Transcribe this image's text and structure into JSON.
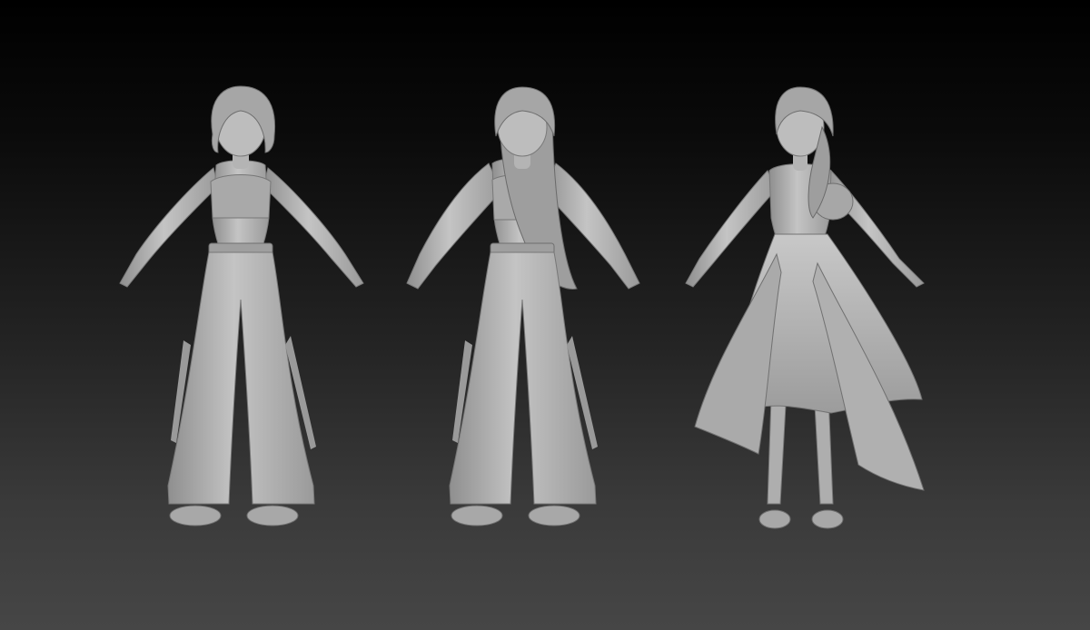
{
  "scene": {
    "background": {
      "top": "#000000",
      "bottom": "#464646"
    },
    "clay_color": "#b9b9b9",
    "clay_shadow": "#8a8a8a",
    "clay_highlight": "#d2d2d2"
  },
  "figures": [
    {
      "id": "fig-1",
      "outfit": "crop-top-cargo-pants",
      "hair": "short-bob"
    },
    {
      "id": "fig-2",
      "outfit": "jacket-cargo-pants",
      "hair": "long-straight"
    },
    {
      "id": "fig-3",
      "outfit": "layered-ruffle-dress",
      "hair": "long-side-ponytail"
    }
  ]
}
